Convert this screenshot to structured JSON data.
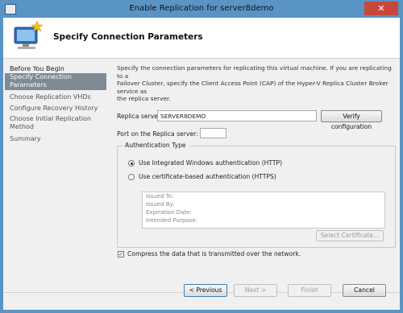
{
  "window": {
    "title": "Enable Replication for server8demo",
    "close_glyph": "✕"
  },
  "header": {
    "heading": "Specify Connection Parameters",
    "icon": "computer-with-star-icon"
  },
  "sidebar": {
    "items": [
      {
        "label": "Before You Begin"
      },
      {
        "label": "Specify Connection"
      },
      {
        "label": "Parameters"
      },
      {
        "label": "Choose Replication VHDs"
      },
      {
        "label": "Configure Recovery History"
      },
      {
        "label": "Choose Initial Replication"
      },
      {
        "label": "Method"
      },
      {
        "label": "Summary"
      }
    ]
  },
  "content": {
    "description_1": "Specify the connection parameters for replicating this virtual machine. If you are replicating to a",
    "description_2": "Failover Cluster, specify the Client Access Point (CAP) of the Hyper-V Replica Cluster Broker service as",
    "description_3": "the replica server.",
    "replica_server_label": "Replica server:",
    "replica_server_value": "SERVER8DEMO",
    "verify_button": "Verify configuration",
    "port_label": "Port on the Replica server:",
    "port_value": "",
    "auth_group_title": "Authentication Type",
    "auth_option_1": "Use Integrated Windows authentication (HTTP)",
    "auth_option_2": "Use certificate-based authentication (HTTPS)",
    "cert_issued_to": "Issued To:",
    "cert_issued_by": "Issued By:",
    "cert_expiration": "Expiration Date:",
    "cert_purpose": "Intended Purpose:",
    "select_cert_button": "Select Certificate...",
    "compress_label": "Compress the data that is transmitted over the network.",
    "compress_checked": true
  },
  "footer": {
    "previous": "< Previous",
    "next": "Next >",
    "finish": "Finish",
    "cancel": "Cancel"
  },
  "colors": {
    "title_bar": "#5a94c4",
    "sidebar_selected": "#7f8a97",
    "close_button": "#c9463d"
  }
}
